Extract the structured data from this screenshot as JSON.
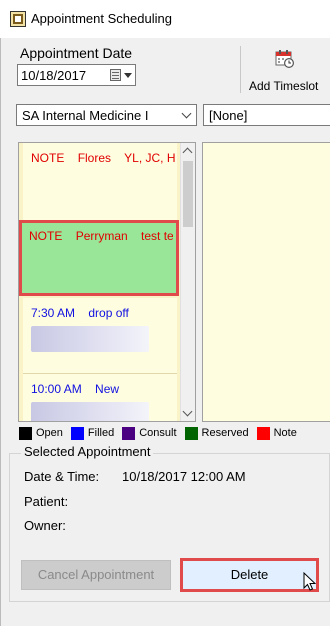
{
  "window": {
    "title": "Appointment Scheduling"
  },
  "header": {
    "date_label": "Appointment Date",
    "date_value": "10/18/2017",
    "add_timeslot_label": "Add Timeslot"
  },
  "filters": {
    "department_value": "SA Internal Medicine I",
    "provider_value": "[None]"
  },
  "appointments": [
    {
      "time": "NOTE",
      "name": "Flores",
      "detail": "YL, JC, HI",
      "type": "note",
      "selected": false
    },
    {
      "time": "NOTE",
      "name": "Perryman",
      "detail": "test te",
      "type": "note",
      "selected": true
    },
    {
      "time": "7:30 AM",
      "name": "drop off",
      "detail": "",
      "type": "open",
      "selected": false
    },
    {
      "time": "10:00 AM",
      "name": "New",
      "detail": "",
      "type": "open",
      "selected": false
    }
  ],
  "legend": [
    {
      "label": "Open",
      "color": "#000000"
    },
    {
      "label": "Filled",
      "color": "#0000ff"
    },
    {
      "label": "Consult",
      "color": "#4b0082"
    },
    {
      "label": "Reserved",
      "color": "#006400"
    },
    {
      "label": "Note",
      "color": "#ff0000"
    }
  ],
  "selected_appointment": {
    "title": "Selected Appointment",
    "datetime_label": "Date & Time:",
    "datetime_value": "10/18/2017 12:00 AM",
    "patient_label": "Patient:",
    "owner_label": "Owner:"
  },
  "actions": {
    "cancel_label": "Cancel Appointment",
    "delete_label": "Delete"
  },
  "colors": {
    "note_text": "#e00000",
    "open_text": "#1010e0",
    "selected_bg": "#99e699",
    "highlight_border": "#e04a4a",
    "pane_bg": "#fbf3c8"
  },
  "icons": {
    "app": "app-icon",
    "calendar": "calendar-dropdown-icon",
    "timeslot": "calendar-clock-icon",
    "cursor": "mouse-pointer-icon"
  }
}
